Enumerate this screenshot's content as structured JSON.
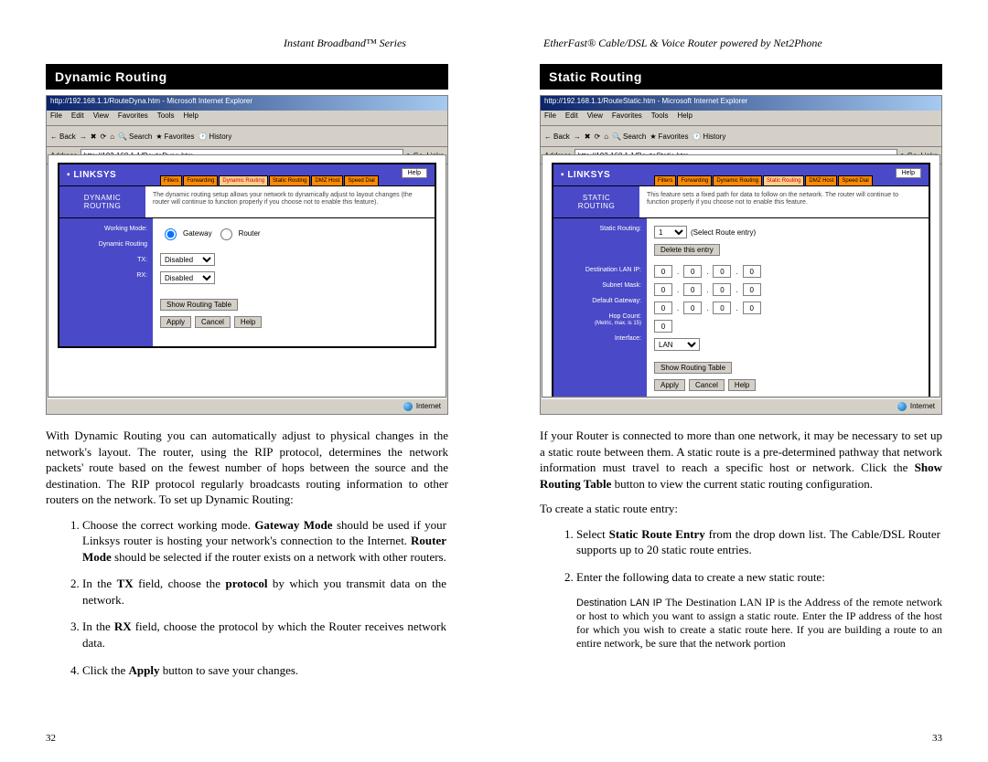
{
  "headers": {
    "left": "Instant Broadband™ Series",
    "right": "EtherFast® Cable/DSL & Voice Router powered by Net2Phone"
  },
  "left_page": {
    "section_title": "Dynamic Routing",
    "ie": {
      "title": "http://192.168.1.1/RouteDyna.htm - Microsoft Internet Explorer",
      "menu": [
        "File",
        "Edit",
        "View",
        "Favorites",
        "Tools",
        "Help"
      ],
      "toolbar": {
        "back": "Back",
        "search": "Search",
        "favorites": "Favorites",
        "history": "History"
      },
      "addr_label": "Address",
      "addr_value": "http://192.168.1.1/RouteDyna.htm",
      "go": "Go",
      "links": "Links",
      "status": "Internet"
    },
    "linksys": {
      "logo": "LINKSYS",
      "tabs": [
        "Filters",
        "Forwarding",
        "Dynamic Routing",
        "Static Routing",
        "DMZ Host",
        "Speed Dial"
      ],
      "help": "Help",
      "side_title_1": "DYNAMIC",
      "side_title_2": "ROUTING",
      "desc": "The dynamic routing setup allows your network to dynamically adjust to layout changes (the router will continue to function properly if you choose not to enable this feature).",
      "labels": [
        "Working Mode:",
        "Dynamic Routing",
        "TX:",
        "RX:"
      ],
      "mode_gateway": "Gateway",
      "mode_router": "Router",
      "tx_value": "Disabled",
      "rx_value": "Disabled",
      "show_btn": "Show Routing Table",
      "apply": "Apply",
      "cancel": "Cancel",
      "helpb": "Help"
    },
    "para": "With Dynamic Routing you can automatically adjust to physical changes in the network's layout. The router, using the RIP protocol, determines the network packets' route based on the fewest number of hops between the source and the destination. The RIP protocol regularly broadcasts routing information to other routers on the network. To set up Dynamic Routing:",
    "steps": [
      {
        "pre": "Choose the correct working mode. ",
        "b1": "Gateway Mode",
        "mid": " should be used if your Linksys router is hosting your network's connection to the Internet. ",
        "b2": "Router Mode",
        "post": " should be selected if the router exists on a network with other routers."
      },
      {
        "pre": "In the ",
        "b1": "TX",
        "mid": " field, choose the ",
        "b2": "protocol",
        "post": " by which you transmit data on the network."
      },
      {
        "pre": "In the ",
        "b1": "RX",
        "post": " field, choose the protocol by which the Router receives network data."
      },
      {
        "pre": "Click the ",
        "b1": "Apply",
        "post": " button to save your changes."
      }
    ],
    "page_num": "32"
  },
  "right_page": {
    "section_title": "Static Routing",
    "ie": {
      "title": "http://192.168.1.1/RouteStatic.htm - Microsoft Internet Explorer",
      "menu": [
        "File",
        "Edit",
        "View",
        "Favorites",
        "Tools",
        "Help"
      ],
      "addr_label": "Address",
      "addr_value": "http://192.168.1.1/RouteStatic.htm",
      "go": "Go",
      "links": "Links",
      "status": "Internet"
    },
    "linksys": {
      "logo": "LINKSYS",
      "tabs": [
        "Filters",
        "Forwarding",
        "Dynamic Routing",
        "Static Routing",
        "DMZ Host",
        "Speed Dial"
      ],
      "help": "Help",
      "side_title_1": "STATIC",
      "side_title_2": "ROUTING",
      "desc": "This feature sets a fixed path for data to follow on the network. The router will continue to function properly if you choose not to enable this feature.",
      "labels": [
        "Static Routing:",
        "Destination LAN IP:",
        "Subnet Mask:",
        "Default Gateway:",
        "Hop Count:",
        "(Metric, max. is 15)",
        "Interface:"
      ],
      "entry_sel": "1",
      "entry_hint": "(Select Route entry)",
      "delete_btn": "Delete this entry",
      "ip_zero": "0",
      "iface": "LAN",
      "show_btn": "Show Routing Table",
      "apply": "Apply",
      "cancel": "Cancel",
      "helpb": "Help"
    },
    "para1": "If your Router is connected to more than one network, it may be necessary to set up a static route between them. A static route is a pre-determined pathway that network information must travel to reach a specific host or network. Click the ",
    "para1_b": "Show Routing Table",
    "para1_post": " button to view the current static routing configuration.",
    "para2": "To create a static route entry:",
    "steps": [
      {
        "pre": "Select ",
        "b1": "Static Route Entry",
        "post": " from the drop down list. The Cable/DSL Router supports up to 20 static route entries."
      },
      {
        "pre": "Enter the following data to create a new static route:"
      }
    ],
    "sub": {
      "label": "Destination LAN IP",
      "text": " The Destination LAN IP is the Address of the remote network or host to which you want to assign a static route. Enter the IP address of the host for which you wish to create a static route here. If you are building a route to an entire network, be sure that the network portion"
    },
    "page_num": "33"
  }
}
